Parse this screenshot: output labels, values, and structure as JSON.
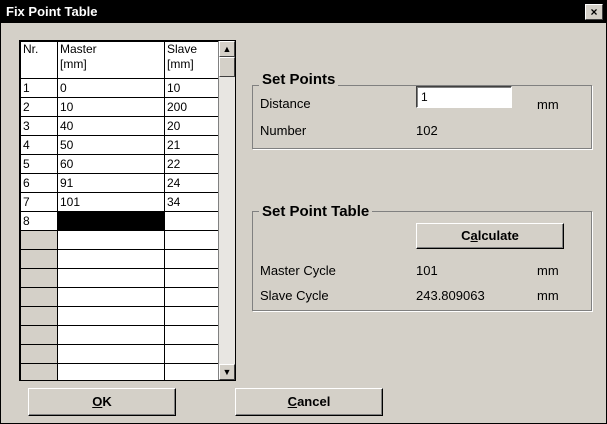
{
  "window": {
    "title": "Fix Point Table",
    "close_glyph": "×"
  },
  "grid": {
    "headers": {
      "nr": "Nr.",
      "master_line1": "Master",
      "master_line2": "[mm]",
      "slave_line1": "Slave",
      "slave_line2": "[mm]"
    },
    "rows": [
      {
        "nr": "1",
        "master": "0",
        "slave": "10"
      },
      {
        "nr": "2",
        "master": "10",
        "slave": "200"
      },
      {
        "nr": "3",
        "master": "40",
        "slave": "20"
      },
      {
        "nr": "4",
        "master": "50",
        "slave": "21"
      },
      {
        "nr": "5",
        "master": "60",
        "slave": "22"
      },
      {
        "nr": "6",
        "master": "91",
        "slave": "24"
      },
      {
        "nr": "7",
        "master": "101",
        "slave": "34"
      },
      {
        "nr": "8",
        "master": "",
        "slave": ""
      }
    ],
    "scroll_up_glyph": "▲",
    "scroll_down_glyph": "▼"
  },
  "set_points": {
    "title": "Set Points",
    "distance_label": "Distance",
    "distance_value": "1",
    "distance_unit": "mm",
    "number_label": "Number",
    "number_value": "102"
  },
  "set_point_table": {
    "title": "Set Point Table",
    "calculate_pre": "C",
    "calculate_accel": "a",
    "calculate_post": "lculate",
    "master_cycle_label": "Master Cycle",
    "master_cycle_value": "101",
    "master_cycle_unit": "mm",
    "slave_cycle_label": "Slave Cycle",
    "slave_cycle_value": "243.809063",
    "slave_cycle_unit": "mm"
  },
  "buttons": {
    "ok_accel": "O",
    "ok_rest": "K",
    "cancel_accel": "C",
    "cancel_rest": "ancel"
  }
}
